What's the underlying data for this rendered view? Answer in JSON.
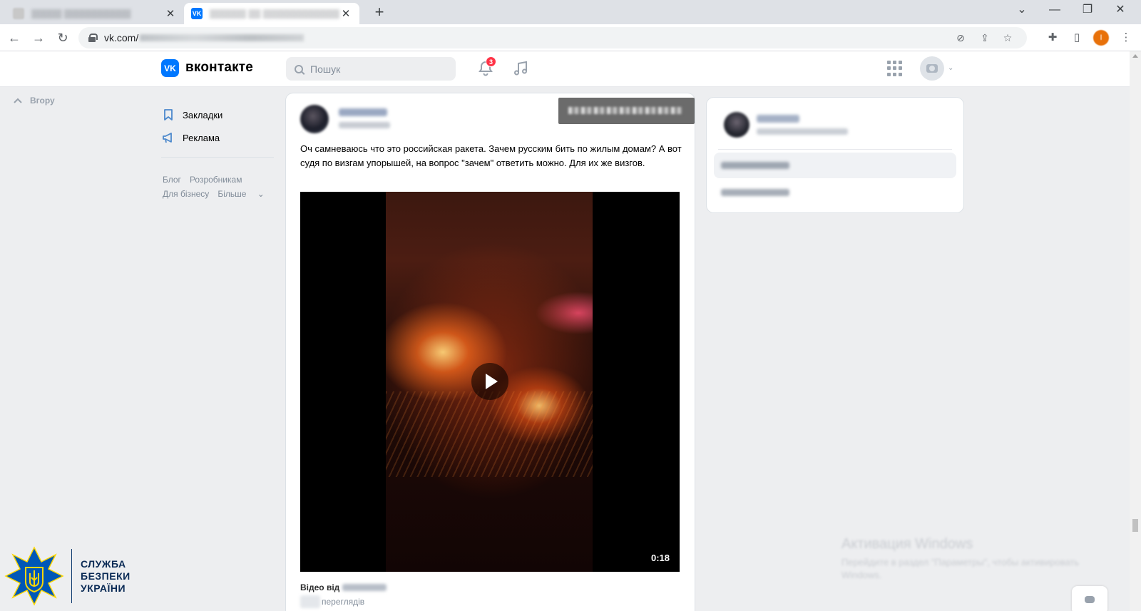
{
  "browser": {
    "tabs": [
      {
        "title": "▒▒▒▒▒ ▒▒▒▒▒▒▒▒▒▒▒",
        "active": false
      },
      {
        "title": "▒▒▒▒▒▒ ▒▒ ▒▒▒▒▒▒▒▒▒▒▒▒▒▒",
        "active": true
      }
    ],
    "url_prefix": "vk.com/",
    "favicon_label": "VK",
    "profile_initial": "I"
  },
  "vk": {
    "brand": "вконтакте",
    "logo_label": "VK",
    "search_placeholder": "Пошук",
    "notifications_count": "3"
  },
  "left": {
    "back_label": "Вгору",
    "nav": [
      {
        "label": "Закладки",
        "icon": "bookmark-icon"
      },
      {
        "label": "Реклама",
        "icon": "megaphone-icon"
      }
    ],
    "footer_links": [
      "Блог",
      "Розробникам",
      "Для бізнесу",
      "Більше"
    ]
  },
  "post": {
    "text": "Оч самневаюсь что это российская ракета. Зачем русским бить по жилым домам? А вот судя по визгам упорышей, на вопрос \"зачем\" ответить можно. Для их же визгов.",
    "video_duration": "0:18",
    "video_title": "Відео від",
    "video_views": "переглядів"
  },
  "branding": {
    "line1": "СЛУЖБА",
    "line2": "БЕЗПЕКИ",
    "line3": "УКРАЇНИ",
    "colors": {
      "blue": "#0057b7",
      "gold": "#ffd700"
    }
  },
  "watermark": {
    "title": "Активация Windows",
    "subtitle": "Перейдите в раздел \"Параметры\", чтобы активировать Windows."
  },
  "colors": {
    "vk_blue": "#0077ff",
    "badge_red": "#ff3347",
    "page_bg": "#edeef0"
  }
}
